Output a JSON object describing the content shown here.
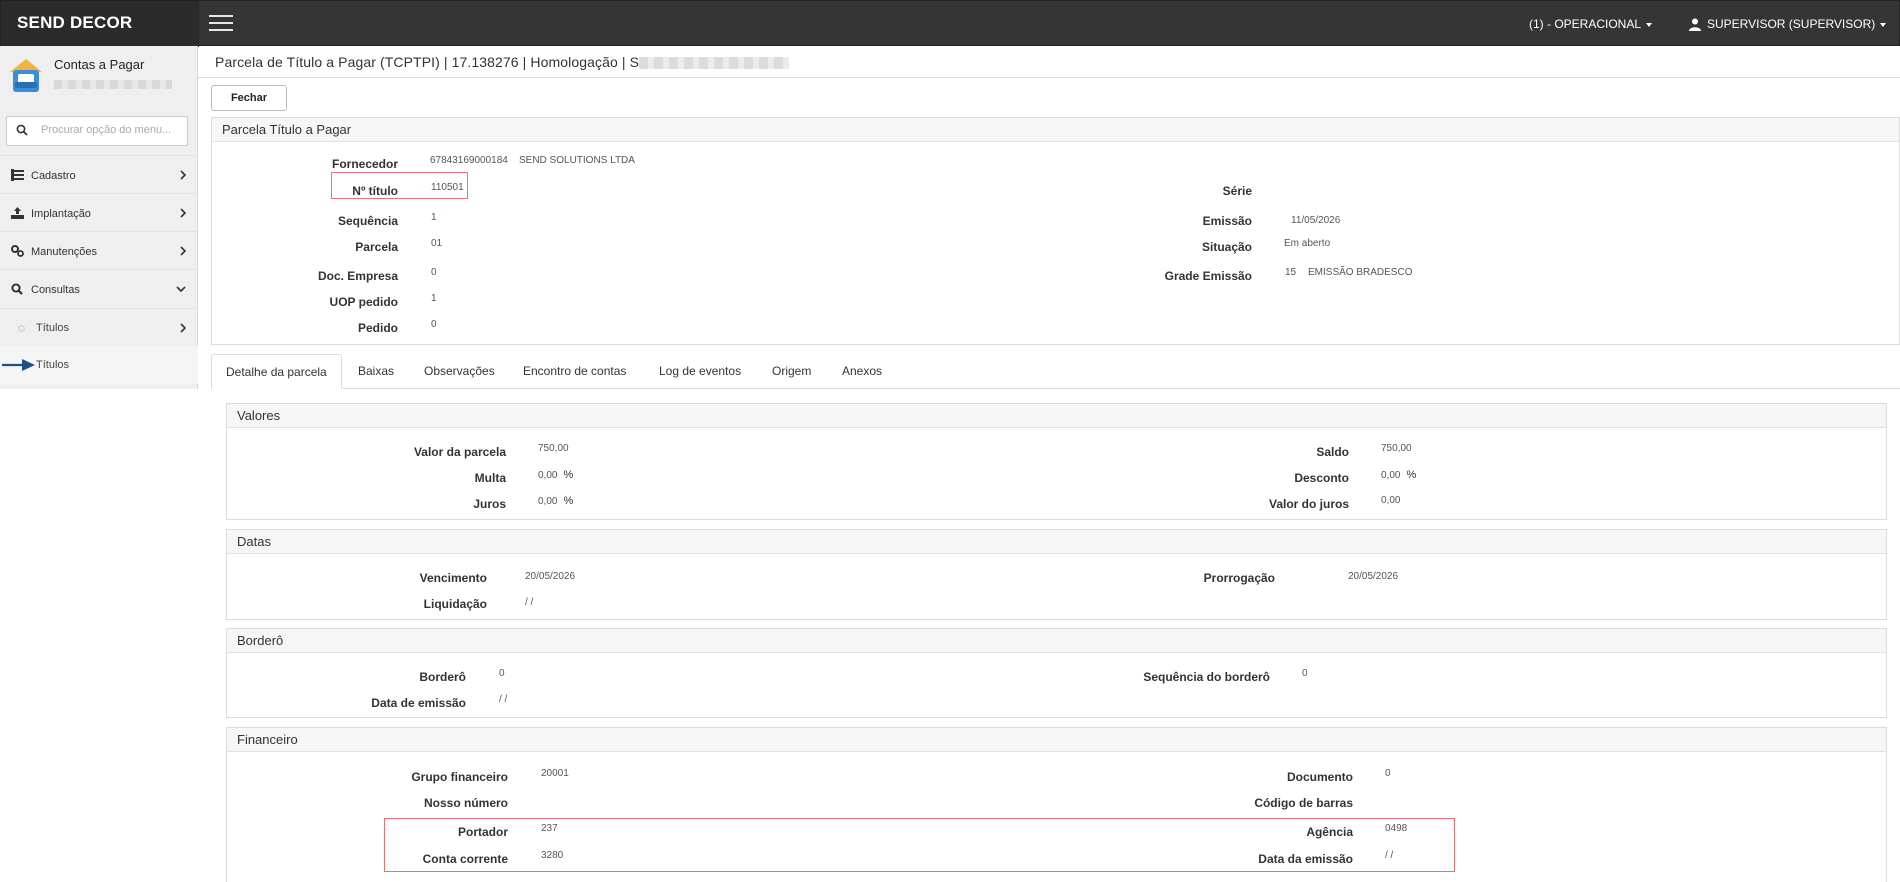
{
  "topbar": {
    "brand": "SEND DECOR",
    "context": "(1) - OPERACIONAL",
    "user": "SUPERVISOR (SUPERVISOR)"
  },
  "sidebar": {
    "module_title": "Contas a Pagar",
    "search_placeholder": "Procurar opção do menu...",
    "items": [
      {
        "label": "Cadastro",
        "icon": "list-icon"
      },
      {
        "label": "Implantação",
        "icon": "upload-icon"
      },
      {
        "label": "Manutenções",
        "icon": "gears-icon"
      },
      {
        "label": "Consultas",
        "icon": "search-icon"
      }
    ],
    "sub_items": [
      {
        "label": "Títulos"
      },
      {
        "label": "Títulos"
      }
    ]
  },
  "header": {
    "title": "Parcela de Título a Pagar (TCPTPI) | 17.138276 | Homologação | S"
  },
  "toolbar": {
    "close_label": "Fechar"
  },
  "summary": {
    "title": "Parcela Título a Pagar",
    "fornecedor_label": "Fornecedor",
    "fornecedor_code": "67843169000184",
    "fornecedor_name": "SEND SOLUTIONS LTDA",
    "titulo_label": "Nº título",
    "titulo_value": "110501",
    "sequencia_label": "Sequência",
    "sequencia_value": "1",
    "parcela_label": "Parcela",
    "parcela_value": "01",
    "doc_empresa_label": "Doc. Empresa",
    "doc_empresa_value": "0",
    "uop_label": "UOP pedido",
    "uop_value": "1",
    "pedido_label": "Pedido",
    "pedido_value": "0",
    "serie_label": "Série",
    "serie_value": "",
    "emissao_label": "Emissão",
    "emissao_value": "11/05/2026",
    "situacao_label": "Situação",
    "situacao_value": "Em aberto",
    "grade_label": "Grade Emissão",
    "grade_code": "15",
    "grade_name": "EMISSÃO BRADESCO"
  },
  "tabs": [
    "Detalhe da parcela",
    "Baixas",
    "Observações",
    "Encontro de contas",
    "Log de eventos",
    "Origem",
    "Anexos"
  ],
  "valores": {
    "title": "Valores",
    "valor_parcela_label": "Valor da parcela",
    "valor_parcela": "750,00",
    "multa_label": "Multa",
    "multa": "0,00",
    "juros_label": "Juros",
    "juros": "0,00",
    "saldo_label": "Saldo",
    "saldo": "750,00",
    "desconto_label": "Desconto",
    "desconto": "0,00",
    "valor_juros_label": "Valor do juros",
    "valor_juros": "0,00",
    "percent": "%"
  },
  "datas": {
    "title": "Datas",
    "vencimento_label": "Vencimento",
    "vencimento": "20/05/2026",
    "liquidacao_label": "Liquidação",
    "liquidacao": "/ /",
    "prorrogacao_label": "Prorrogação",
    "prorrogacao": "20/05/2026"
  },
  "bordero": {
    "title": "Borderô",
    "bordero_label": "Borderô",
    "bordero": "0",
    "data_emissao_label": "Data de emissão",
    "data_emissao": "/ /",
    "sequencia_label": "Sequência do borderô",
    "sequencia": "0"
  },
  "financeiro": {
    "title": "Financeiro",
    "grupo_label": "Grupo financeiro",
    "grupo": "20001",
    "nosso_numero_label": "Nosso número",
    "nosso_numero": "",
    "portador_label": "Portador",
    "portador": "237",
    "conta_label": "Conta corrente",
    "conta": "3280",
    "documento_label": "Documento",
    "documento": "0",
    "codigo_barras_label": "Código de barras",
    "codigo_barras": "",
    "agencia_label": "Agência",
    "agencia": "0498",
    "data_emissao_label": "Data da emissão",
    "data_emissao": "/ /"
  },
  "colors": {
    "accent_red": "#e57373",
    "topbar": "#353535",
    "arrow": "#1f4e8c"
  }
}
